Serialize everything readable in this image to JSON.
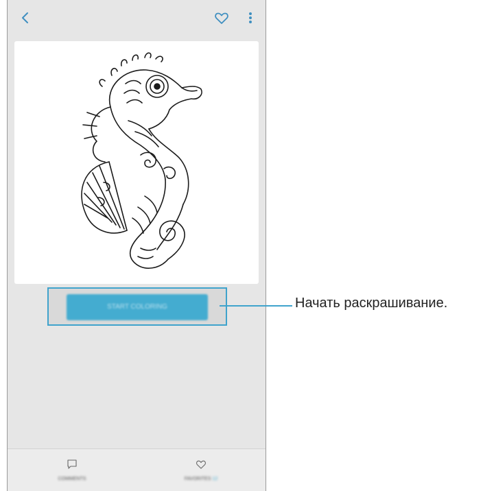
{
  "app": {
    "header": {
      "back_icon": "chevron-left-icon",
      "favorite_icon": "heart-outline-icon",
      "more_icon": "more-vertical-icon"
    },
    "artwork": {
      "subject": "seahorse-coloring-page"
    },
    "actions": {
      "start_label": "START COLORING"
    },
    "bottom_nav": {
      "comments_label": "COMMENTS",
      "comments_icon": "comment-icon",
      "favorites_label": "FAVORITES",
      "favorites_count": "12",
      "favorites_icon": "heart-outline-icon"
    }
  },
  "callout": {
    "text": "Начать раскрашивание."
  },
  "colors": {
    "accent": "#44acd0",
    "highlight": "#3fa3cc",
    "screen_bg": "#e6e6e6"
  }
}
